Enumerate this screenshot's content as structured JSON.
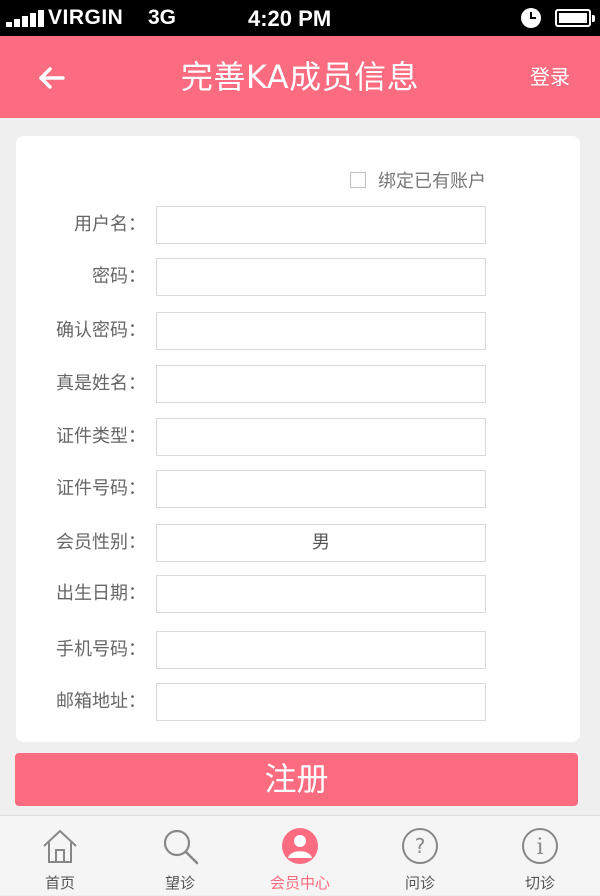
{
  "status_bar": {
    "carrier": "VIRGIN",
    "network": "3G",
    "time": "4:20 PM"
  },
  "nav": {
    "title": "完善KA成员信息",
    "login": "登录",
    "back_icon": "arrow-left-icon"
  },
  "form": {
    "bind_label": "绑定已有账户",
    "bind_checked": false,
    "fields": [
      {
        "label": "用户名：",
        "value": ""
      },
      {
        "label": "密码：",
        "value": ""
      },
      {
        "label": "确认密码：",
        "value": ""
      },
      {
        "label": "真是姓名：",
        "value": ""
      },
      {
        "label": "证件类型：",
        "value": ""
      },
      {
        "label": "证件号码：",
        "value": ""
      },
      {
        "label": "会员性别：",
        "value": "男"
      },
      {
        "label": "出生日期：",
        "value": ""
      },
      {
        "label": "手机号码：",
        "value": ""
      },
      {
        "label": "邮箱地址：",
        "value": ""
      }
    ],
    "submit_label": "注册"
  },
  "tabs": [
    {
      "label": "首页",
      "icon": "home-icon",
      "active": false
    },
    {
      "label": "望诊",
      "icon": "search-icon",
      "active": false
    },
    {
      "label": "会员中心",
      "icon": "user-icon",
      "active": true
    },
    {
      "label": "问诊",
      "icon": "question-icon",
      "active": false
    },
    {
      "label": "切诊",
      "icon": "info-icon",
      "active": false
    }
  ],
  "colors": {
    "accent": "#fc6c80",
    "background": "#efefef",
    "card": "#ffffff"
  }
}
